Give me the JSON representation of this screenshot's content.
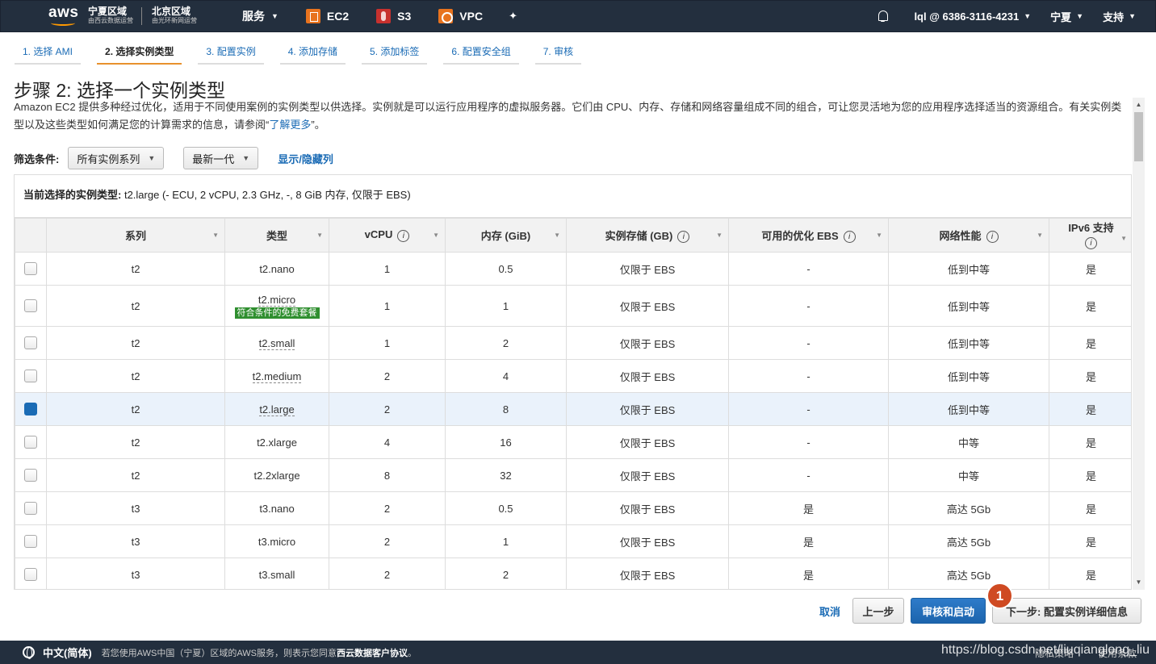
{
  "nav": {
    "logo_text": "aws",
    "region1_main": "宁夏区域",
    "region1_sub": "由西云数据运营",
    "region2_main": "北京区域",
    "region2_sub": "由光环新网运营",
    "services_label": "服务",
    "svc_ec2": "EC2",
    "svc_s3": "S3",
    "svc_vpc": "VPC",
    "account": "lql @ 6386-3116-4231",
    "region_select": "宁夏",
    "support": "支持"
  },
  "steps": [
    "1. 选择 AMI",
    "2. 选择实例类型",
    "3. 配置实例",
    "4. 添加存储",
    "5. 添加标签",
    "6. 配置安全组",
    "7. 审核"
  ],
  "page_title": "步骤 2: 选择一个实例类型",
  "description_before_link": "Amazon EC2 提供多种经过优化，适用于不同使用案例的实例类型以供选择。实例就是可以运行应用程序的虚拟服务器。它们由 CPU、内存、存储和网络容量组成不同的组合，可让您灵活地为您的应用程序选择适当的资源组合。有关实例类型以及这些类型如何满足您的计算需求的信息，请参阅“",
  "description_link": "了解更多",
  "description_after_link": "”。",
  "filter": {
    "label": "筛选条件:",
    "family_select": "所有实例系列",
    "generation_select": "最新一代",
    "toggle_columns": "显示/隐藏列"
  },
  "current_selection": {
    "label": "当前选择的实例类型:",
    "value": "t2.large (- ECU, 2 vCPU, 2.3 GHz, -, 8 GiB 内存, 仅限于 EBS)"
  },
  "table": {
    "headers": [
      "系列",
      "类型",
      "vCPU",
      "内存 (GiB)",
      "实例存储 (GB)",
      "可用的优化 EBS",
      "网络性能",
      "IPv6 支持"
    ],
    "free_tier_label": "符合条件的免费套餐",
    "rows": [
      {
        "family": "t2",
        "type": "t2.nano",
        "vcpu": "1",
        "memory": "0.5",
        "storage": "仅限于 EBS",
        "ebs": "-",
        "network": "低到中等",
        "ipv6": "是"
      },
      {
        "family": "t2",
        "type": "t2.micro",
        "vcpu": "1",
        "memory": "1",
        "storage": "仅限于 EBS",
        "ebs": "-",
        "network": "低到中等",
        "ipv6": "是"
      },
      {
        "family": "t2",
        "type": "t2.small",
        "vcpu": "1",
        "memory": "2",
        "storage": "仅限于 EBS",
        "ebs": "-",
        "network": "低到中等",
        "ipv6": "是"
      },
      {
        "family": "t2",
        "type": "t2.medium",
        "vcpu": "2",
        "memory": "4",
        "storage": "仅限于 EBS",
        "ebs": "-",
        "network": "低到中等",
        "ipv6": "是"
      },
      {
        "family": "t2",
        "type": "t2.large",
        "vcpu": "2",
        "memory": "8",
        "storage": "仅限于 EBS",
        "ebs": "-",
        "network": "低到中等",
        "ipv6": "是"
      },
      {
        "family": "t2",
        "type": "t2.xlarge",
        "vcpu": "4",
        "memory": "16",
        "storage": "仅限于 EBS",
        "ebs": "-",
        "network": "中等",
        "ipv6": "是"
      },
      {
        "family": "t2",
        "type": "t2.2xlarge",
        "vcpu": "8",
        "memory": "32",
        "storage": "仅限于 EBS",
        "ebs": "-",
        "network": "中等",
        "ipv6": "是"
      },
      {
        "family": "t3",
        "type": "t3.nano",
        "vcpu": "2",
        "memory": "0.5",
        "storage": "仅限于 EBS",
        "ebs": "是",
        "network": "高达 5Gb",
        "ipv6": "是"
      },
      {
        "family": "t3",
        "type": "t3.micro",
        "vcpu": "2",
        "memory": "1",
        "storage": "仅限于 EBS",
        "ebs": "是",
        "network": "高达 5Gb",
        "ipv6": "是"
      },
      {
        "family": "t3",
        "type": "t3.small",
        "vcpu": "2",
        "memory": "2",
        "storage": "仅限于 EBS",
        "ebs": "是",
        "network": "高达 5Gb",
        "ipv6": "是"
      }
    ]
  },
  "buttons": {
    "cancel": "取消",
    "previous": "上一步",
    "review_launch": "审核和启动",
    "next": "下一步: 配置实例详细信息"
  },
  "badge_number": "1",
  "footer": {
    "language": "中文(简体)",
    "notice_prefix": "若您使用AWS中国（宁夏）区域的AWS服务，则表示您同意",
    "notice_link": "西云数据客户协议",
    "notice_suffix": "。",
    "privacy": "隐私策略",
    "terms": "使用条款"
  },
  "watermark": "https://blog.csdn.net/liuqianglong_liu",
  "colors": {
    "nav_bg": "#232f3e",
    "link": "#1a6bb5",
    "primary": "#1c64ad",
    "active_step": "#e8912d",
    "free_tier": "#2f8f2f",
    "badge": "#cf4a22",
    "selected_row": "#eaf2fb"
  }
}
